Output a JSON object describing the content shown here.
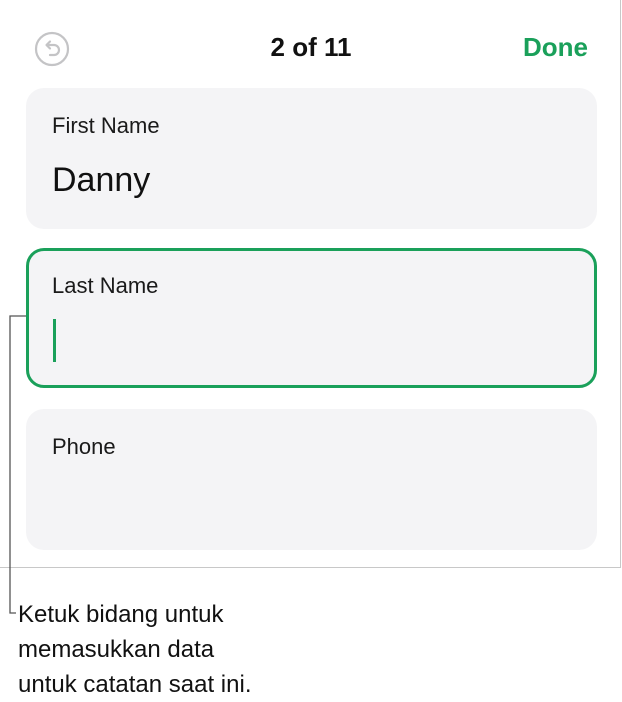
{
  "header": {
    "counter": "2 of 11",
    "done_label": "Done",
    "undo_icon": "undo-arrow-icon"
  },
  "fields": [
    {
      "label": "First Name",
      "value": "Danny"
    },
    {
      "label": "Last Name",
      "value": ""
    },
    {
      "label": "Phone",
      "value": ""
    }
  ],
  "callout": {
    "line1": "Ketuk bidang untuk",
    "line2": "memasukkan data",
    "line3": "untuk catatan saat ini."
  },
  "colors": {
    "accent": "#1aa05a",
    "field_bg": "#f4f4f6"
  }
}
